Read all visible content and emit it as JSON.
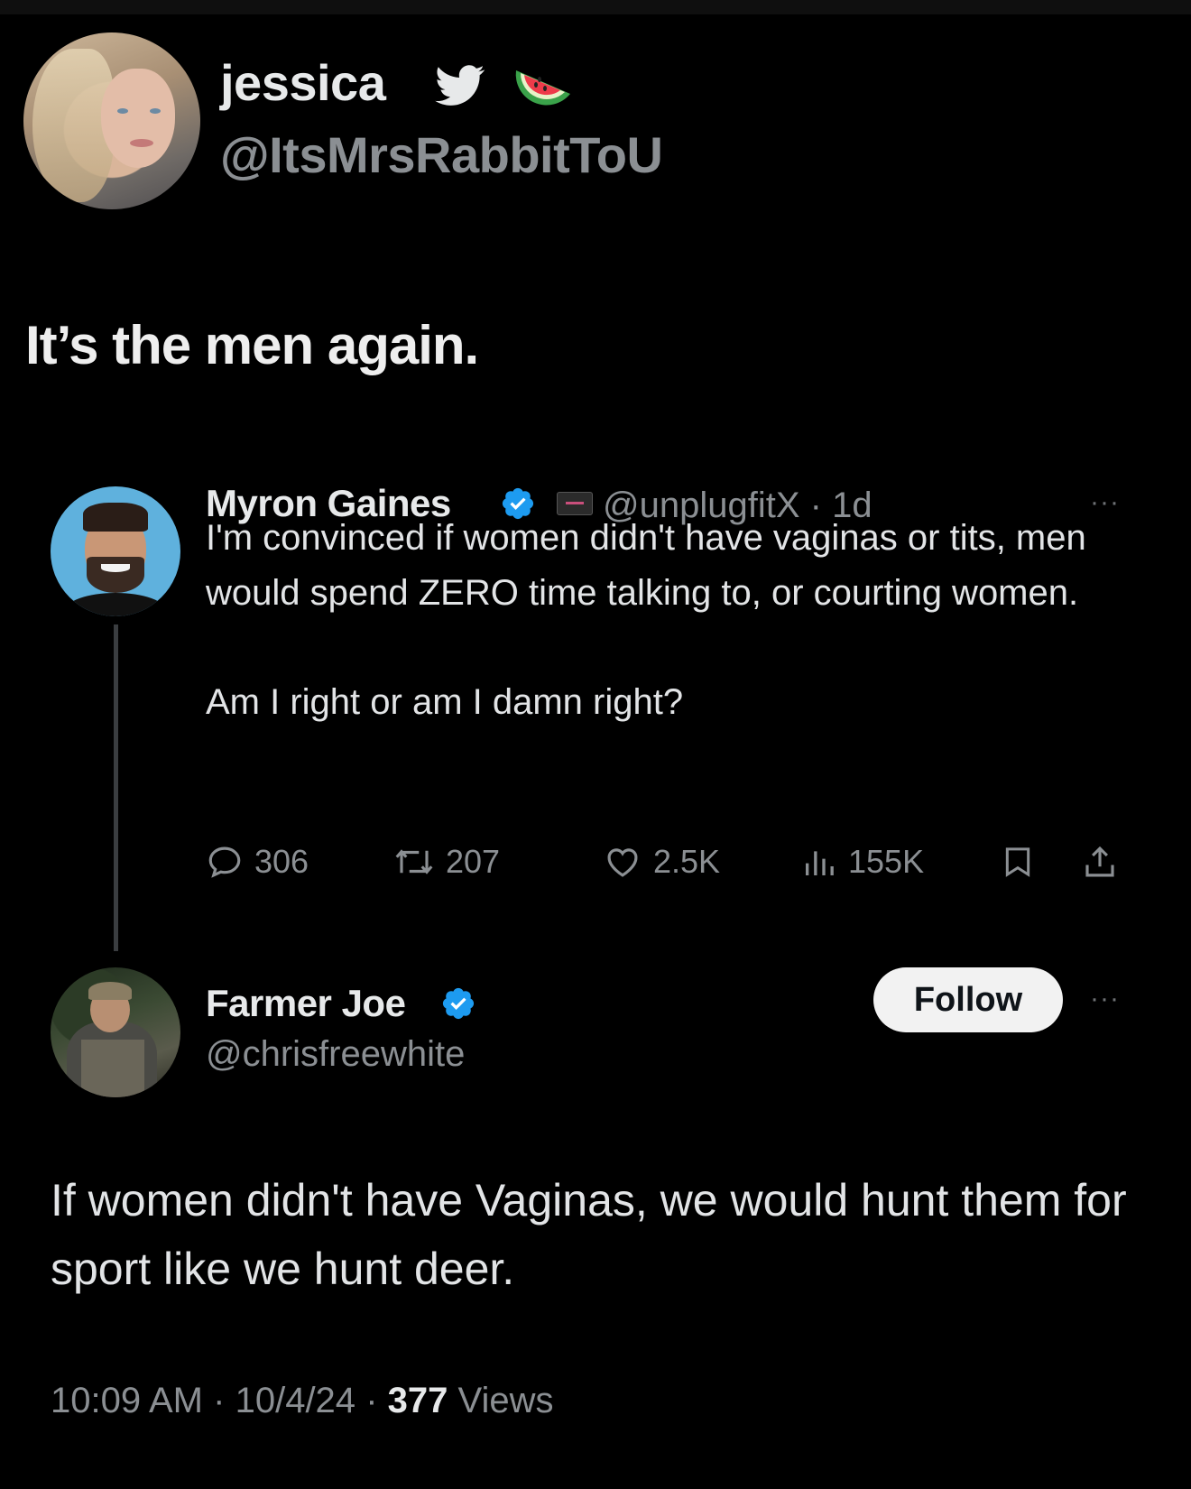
{
  "outer_tweet": {
    "display_name": "jessica",
    "handle": "@ItsMrsRabbitToU",
    "text": "It’s the men again."
  },
  "quoted_tweet": {
    "author_name": "Myron Gaines",
    "handle": "@unplugfitX",
    "separator": "·",
    "age": "1d",
    "more": "···",
    "paragraph_1": "I'm convinced if women didn't have vaginas or tits, men would spend ZERO time talking to, or courting women.",
    "paragraph_2": "Am I right or am I damn right?",
    "stats": {
      "replies": "306",
      "reposts": "207",
      "likes": "2.5K",
      "views": "155K"
    }
  },
  "reply_tweet": {
    "author_name": "Farmer Joe",
    "handle": "@chrisfreewhite",
    "follow_label": "Follow",
    "more": "···",
    "text": "If women didn't have Vaginas, we would hunt them for sport like we hunt deer.",
    "time": "10:09 AM",
    "dot": "·",
    "date": "10/4/24",
    "view_count": "377",
    "views_label": "Views"
  },
  "colors": {
    "background": "#000000",
    "text_primary": "#e7e9ea",
    "text_secondary": "#8b8f93",
    "verified_blue": "#1d9bf0",
    "follow_button": "#f2f2f2"
  },
  "icons": [
    "twitter-bird-icon",
    "watermelon-icon",
    "verified-badge-icon",
    "affiliate-badge-icon",
    "more-icon",
    "reply-icon",
    "repost-icon",
    "like-icon",
    "views-icon",
    "bookmark-icon",
    "share-icon"
  ]
}
